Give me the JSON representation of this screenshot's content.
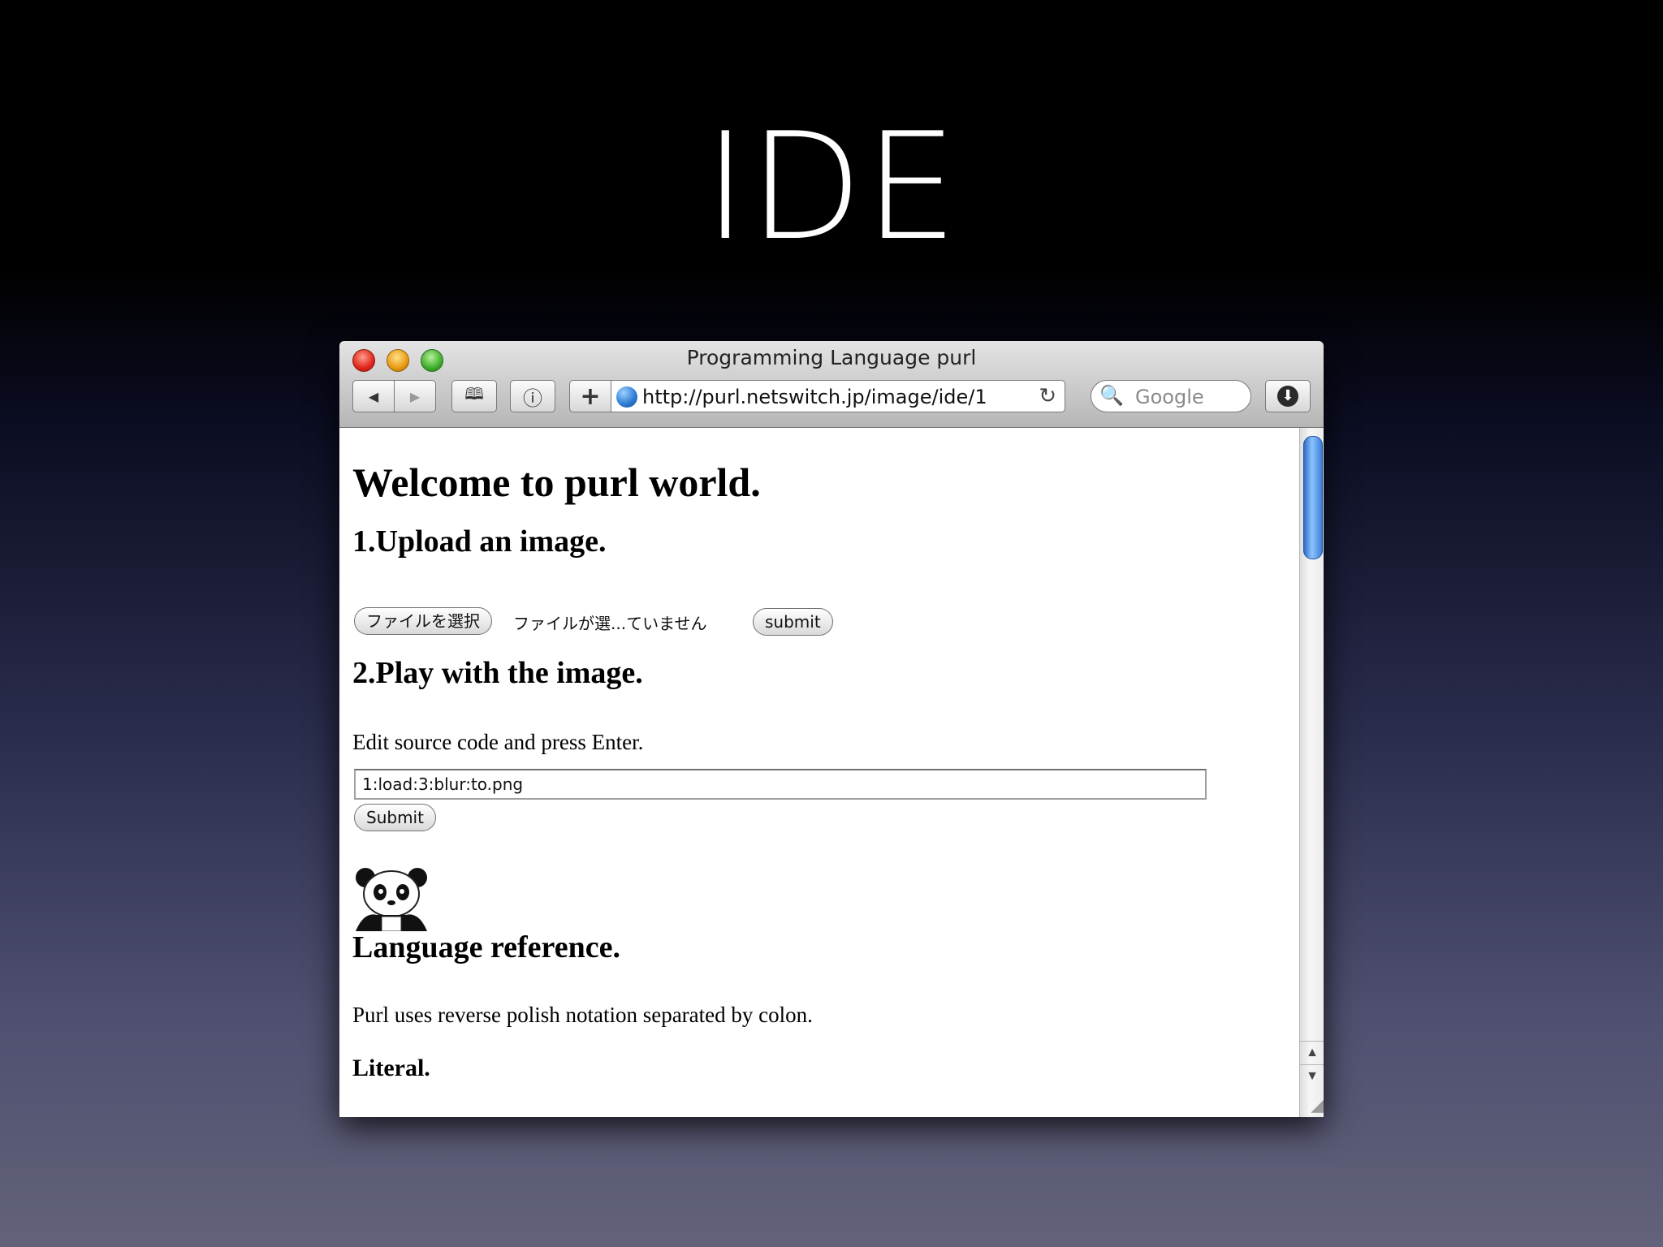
{
  "slide": {
    "title": "IDE"
  },
  "browser": {
    "window_title": "Programming Language purl",
    "url": "http://purl.netswitch.jp/image/ide/1",
    "search_placeholder": "Google",
    "toolbar": {
      "back_icon": "◀",
      "forward_icon": "▶",
      "bookmarks_icon": "🕮",
      "info_icon": "ⓘ",
      "add_icon": "+",
      "reload_icon": "↻",
      "search_icon": "🔍",
      "download_icon": "⬇"
    }
  },
  "page": {
    "heading": "Welcome to purl world.",
    "section1": {
      "title": "1.Upload an image.",
      "choose_file_label": "ファイルを選択",
      "file_status": "ファイルが選...ていません",
      "submit_label": "submit"
    },
    "section2": {
      "title": "2.Play with the image.",
      "instruction": "Edit source code and press Enter.",
      "source_value": "1:load:3:blur:to.png",
      "submit_label": "Submit"
    },
    "reference": {
      "title": "Language reference.",
      "description": "Purl uses reverse polish notation separated by colon.",
      "literal_title": "Literal."
    }
  }
}
